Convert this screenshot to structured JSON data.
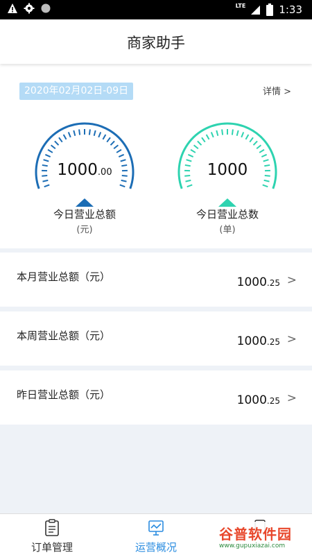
{
  "status_bar": {
    "time": "1:33",
    "network": "LTE",
    "icons": [
      "warning-icon",
      "settings-icon",
      "circle-icon",
      "signal-icon",
      "battery-icon"
    ]
  },
  "header": {
    "title": "商家助手"
  },
  "summary": {
    "date_range": "2020年02月02日-09日",
    "detail_link": "详情 >",
    "gauges": [
      {
        "value_main": "1000",
        "value_fraction": ".00",
        "label": "今日营业总额",
        "unit": "(元)",
        "color": "#1c6db5"
      },
      {
        "value_main": "1000",
        "value_fraction": "",
        "label": "今日营业总数",
        "unit": "(单)",
        "color": "#2ed3b0"
      }
    ]
  },
  "stats": [
    {
      "label": "本月营业总额（元）",
      "value_main": "1000",
      "value_fraction": ".25",
      "chevron": ">"
    },
    {
      "label": "本周营业总额（元）",
      "value_main": "1000",
      "value_fraction": ".25",
      "chevron": ">"
    },
    {
      "label": "昨日营业总额（元）",
      "value_main": "1000",
      "value_fraction": ".25",
      "chevron": ">"
    }
  ],
  "bottom_nav": {
    "items": [
      {
        "label": "订单管理",
        "icon": "clipboard-icon",
        "active": false
      },
      {
        "label": "运营概况",
        "icon": "chart-monitor-icon",
        "active": true
      },
      {
        "label": "",
        "icon": "user-icon",
        "active": false
      }
    ],
    "active_color": "#2a8ce0"
  },
  "watermark": {
    "text": "谷普软件园",
    "url": "www.gupuxiazai.com"
  }
}
